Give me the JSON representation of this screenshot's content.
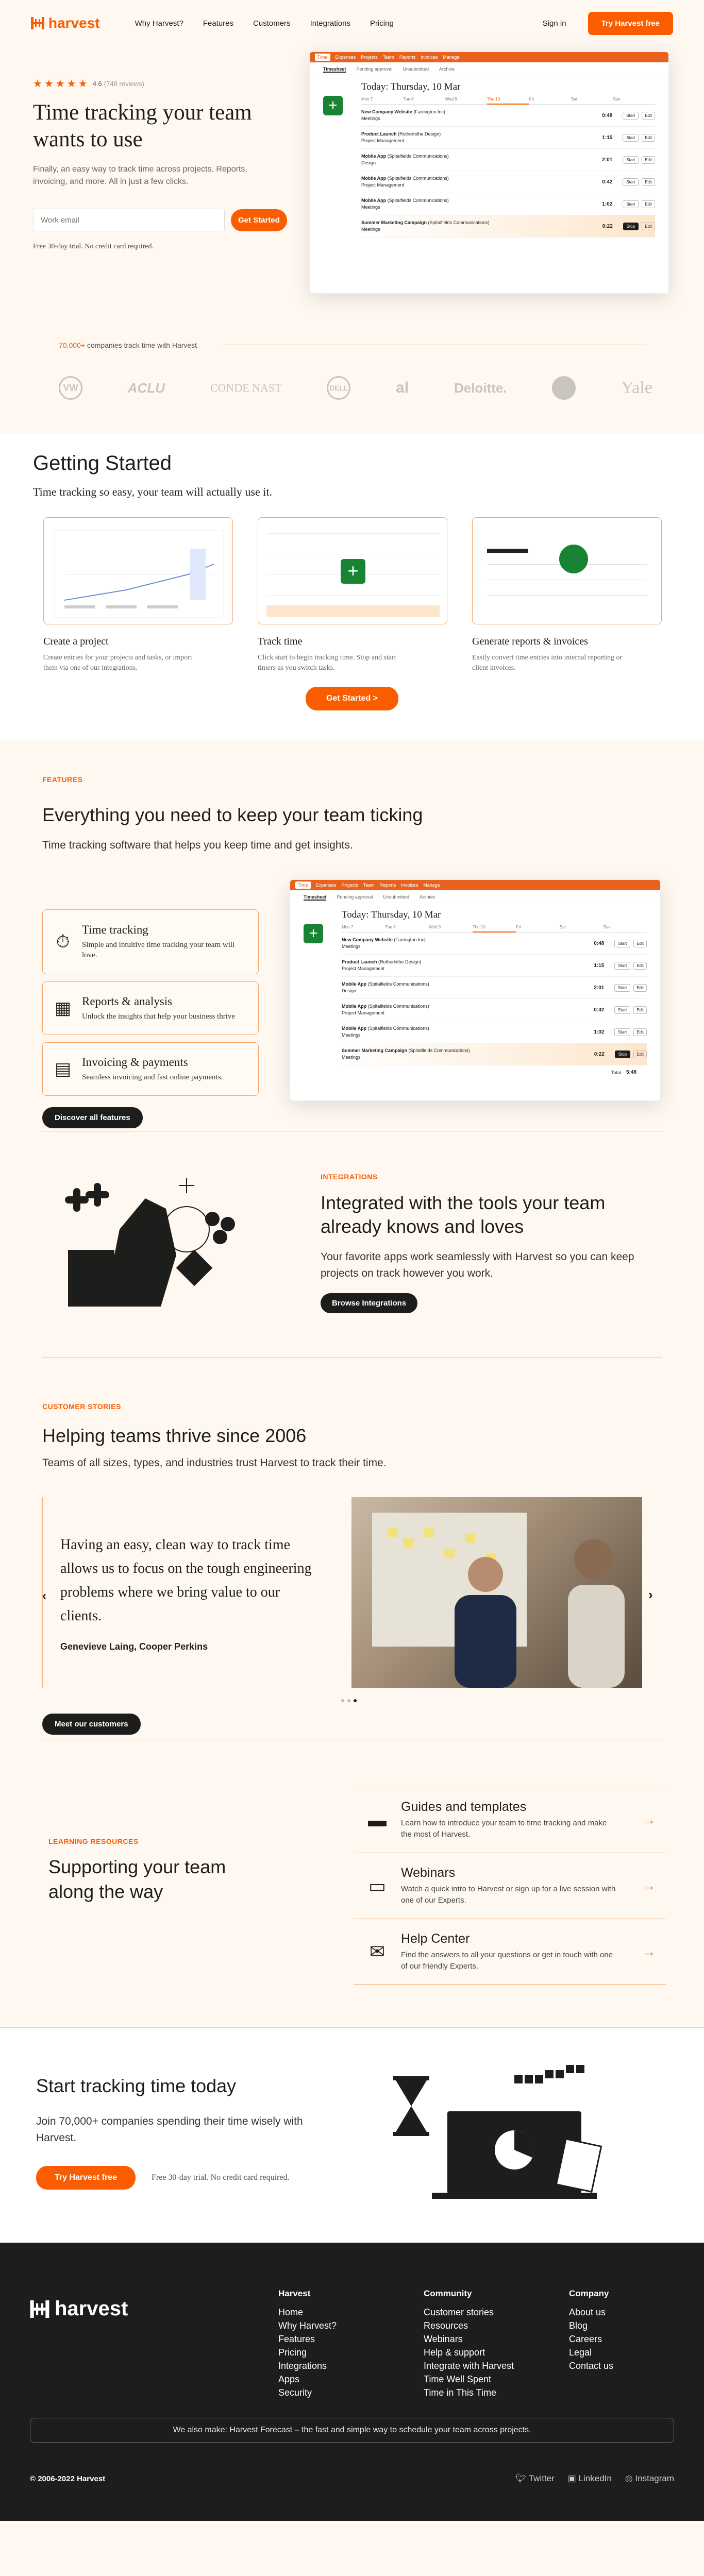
{
  "nav": {
    "brand": "harvest",
    "links": [
      "Why Harvest?",
      "Features",
      "Customers",
      "Integrations",
      "Pricing"
    ],
    "signin": "Sign in",
    "cta": "Try Harvest free"
  },
  "hero": {
    "rating": "4.6",
    "reviews": "(748 reviews)",
    "title": "Time tracking your team wants to use",
    "subtitle": "Finally, an easy way to track time across projects. Reports, invoicing, and more. All in just a few clicks.",
    "email_placeholder": "Work email",
    "button": "Get Started",
    "fine": "Free 30-day trial. No credit card required."
  },
  "appmock": {
    "topnav": [
      "Time",
      "Expenses",
      "Projects",
      "Team",
      "Reports",
      "Invoices",
      "Manage"
    ],
    "tabs": [
      "Timesheet",
      "Pending approval",
      "Unsubmitted",
      "Archive"
    ],
    "date": "Today: Thursday, 10 Mar",
    "days": [
      "Mon 7",
      "Tue 8",
      "Wed 9",
      "Thu 10",
      "Fri",
      "Sat",
      "Sun"
    ],
    "entries": [
      {
        "project": "New Company Website",
        "client": "(Farrington Inc)",
        "task": "Meetings",
        "hours": "0:48"
      },
      {
        "project": "Product Launch",
        "client": "(Rotherhithe Design)",
        "task": "Project Management",
        "hours": "1:15"
      },
      {
        "project": "Mobile App",
        "client": "(Spitalfields Communications)",
        "task": "Design",
        "hours": "2:01"
      },
      {
        "project": "Mobile App",
        "client": "(Spitalfields Communications)",
        "task": "Project Management",
        "hours": "0:42"
      },
      {
        "project": "Mobile App",
        "client": "(Spitalfields Communications)",
        "task": "Meetings",
        "hours": "1:02"
      },
      {
        "project": "Summer Marketing Campaign",
        "client": "(Spitalfields Communications)",
        "task": "Meetings",
        "hours": "0:22"
      }
    ],
    "start": "Start",
    "stop": "Stop",
    "edit": "Edit",
    "total_label": "Total",
    "total": "5:48"
  },
  "trust": {
    "count": "70,000+",
    "text": "companies track time with Harvest",
    "logos": [
      "VW",
      "ACLU",
      "CONDE NAST",
      "DELL",
      "al",
      "Deloitte.",
      "lululemon",
      "Yale"
    ]
  },
  "getting_started": {
    "title": "Getting Started",
    "subtitle": "Time tracking so easy, your team will actually use it.",
    "cards": [
      {
        "title": "Create a project",
        "text": "Create entries for your projects and tasks, or import them via one of our integrations."
      },
      {
        "title": "Track time",
        "text": "Click start to begin tracking time. Stop and start timers as you switch tasks."
      },
      {
        "title": "Generate reports & invoices",
        "text": "Easily convert time entries into internal reporting or client invoices."
      }
    ],
    "button": "Get Started >"
  },
  "features": {
    "eyebrow": "FEATURES",
    "title": "Everything you need to keep your team ticking",
    "subtitle": "Time tracking software that helps you keep time and get insights.",
    "items": [
      {
        "title": "Time tracking",
        "text": "Simple and intuitive time tracking your team will love."
      },
      {
        "title": "Reports & analysis",
        "text": "Unlock the insights that help your business thrive"
      },
      {
        "title": "Invoicing & payments",
        "text": "Seamless invoicing and fast online payments."
      }
    ],
    "button": "Discover all features"
  },
  "integrations": {
    "eyebrow": "INTEGRATIONS",
    "title": "Integrated with the tools your team already knows and loves",
    "subtitle": "Your favorite apps work seamlessly with Harvest so you can keep projects on track however you work.",
    "button": "Browse Integrations"
  },
  "stories": {
    "eyebrow": "CUSTOMER STORIES",
    "title": "Helping teams thrive since 2006",
    "subtitle": "Teams of all sizes, types, and industries trust Harvest to track their time.",
    "quote": "Having an easy, clean way to track time allows us to focus on the tough engineering problems where we bring value to our clients.",
    "author": "Genevieve Laing, Cooper Perkins",
    "button": "Meet our customers"
  },
  "learning": {
    "eyebrow": "LEARNING RESOURCES",
    "title": "Supporting your team along the way",
    "items": [
      {
        "title": "Guides and templates",
        "text": "Learn how to introduce your team to time tracking and make the most of Harvest.",
        "icon": "folder-icon"
      },
      {
        "title": "Webinars",
        "text": "Watch a quick intro to Harvest or sign up for a live session with one of our Experts.",
        "icon": "laptop-icon"
      },
      {
        "title": "Help Center",
        "text": "Find the answers to all your questions or get in touch with one of our friendly Experts.",
        "icon": "chat-icon"
      }
    ]
  },
  "cta": {
    "title": "Start tracking time today",
    "subtitle": "Join 70,000+ companies spending their time wisely with Harvest.",
    "button": "Try Harvest free",
    "fine": "Free 30-day trial. No credit card required."
  },
  "footer": {
    "brand": "harvest",
    "columns": [
      {
        "title": "Harvest",
        "links": [
          "Home",
          "Why Harvest?",
          "Features",
          "Pricing",
          "Integrations",
          "Apps",
          "Security"
        ]
      },
      {
        "title": "Community",
        "links": [
          "Customer stories",
          "Resources",
          "Webinars",
          "Help & support",
          "Integrate with Harvest",
          "Time Well Spent",
          "Time in This Time"
        ]
      },
      {
        "title": "Company",
        "links": [
          "About us",
          "Blog",
          "Careers",
          "Legal",
          "Contact us"
        ]
      }
    ],
    "forecast": "We also make: Harvest Forecast – the fast and simple way to schedule your team across projects.",
    "copyright": "© 2006-2022 Harvest",
    "social": [
      "Twitter",
      "LinkedIn",
      "Instagram"
    ]
  },
  "colors": {
    "brand": "#fa5d00",
    "dark": "#1d1e1c",
    "bg": "#fff8f1",
    "green": "#188433"
  }
}
